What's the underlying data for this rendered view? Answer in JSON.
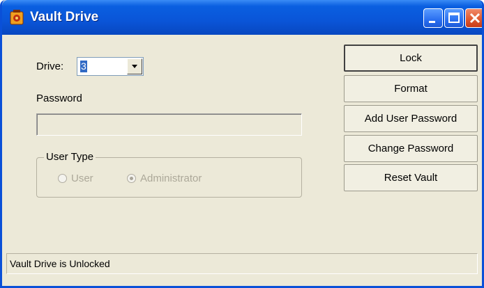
{
  "window": {
    "title": "Vault Drive"
  },
  "titlebar_buttons": [
    "minimize-icon",
    "maximize-icon",
    "close-icon"
  ],
  "drive": {
    "label": "Drive:",
    "selected": "3"
  },
  "password": {
    "label": "Password",
    "value": ""
  },
  "user_type": {
    "title": "User Type",
    "options": [
      {
        "label": "User",
        "selected": false
      },
      {
        "label": "Administrator",
        "selected": true
      }
    ]
  },
  "buttons": {
    "lock": "Lock",
    "format": "Format",
    "add_user_password": "Add User Password",
    "change_password": "Change Password",
    "reset_vault": "Reset Vault"
  },
  "status": {
    "text": "Vault Drive is Unlocked"
  },
  "colors": {
    "titlebar": "#0a55d8",
    "window_bg": "#ece9d8",
    "selection": "#316ac5"
  }
}
